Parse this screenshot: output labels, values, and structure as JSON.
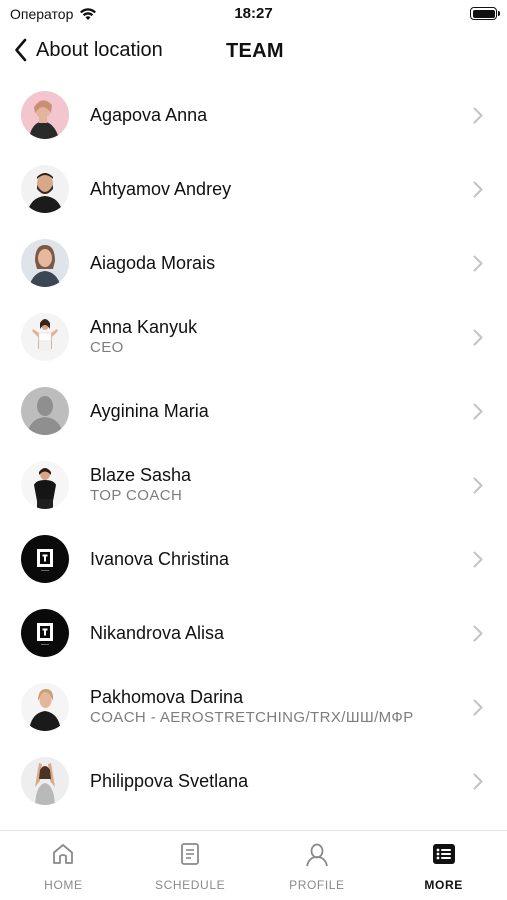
{
  "status": {
    "carrier": "Оператор",
    "time": "18:27"
  },
  "nav": {
    "back_label": "About location",
    "title": "TEAM"
  },
  "members": [
    {
      "name": "Agapova Anna",
      "role": "",
      "avatar": "photo-portrait"
    },
    {
      "name": "Ahtyamov Andrey",
      "role": "",
      "avatar": "photo-portrait"
    },
    {
      "name": "Aiagoda Morais",
      "role": "",
      "avatar": "photo-portrait"
    },
    {
      "name": "Anna Kanyuk",
      "role": "CEO",
      "avatar": "photo-portrait"
    },
    {
      "name": "Ayginina Maria",
      "role": "",
      "avatar": "placeholder-silhouette"
    },
    {
      "name": "Blaze Sasha",
      "role": "TOP COACH",
      "avatar": "photo-portrait"
    },
    {
      "name": "Ivanova Christina",
      "role": "",
      "avatar": "brand-logo"
    },
    {
      "name": "Nikandrova Alisa",
      "role": "",
      "avatar": "brand-logo"
    },
    {
      "name": "Pakhomova Darina",
      "role": "COACH - AEROSTRETCHING/TRX/ШШ/МФР",
      "avatar": "photo-portrait"
    },
    {
      "name": "Philippova Svetlana",
      "role": "",
      "avatar": "photo-portrait"
    },
    {
      "name": "",
      "role": "",
      "avatar": "brand-logo"
    }
  ],
  "tabs": [
    {
      "id": "home",
      "label": "HOME",
      "icon": "home-icon",
      "active": false
    },
    {
      "id": "schedule",
      "label": "SCHEDULE",
      "icon": "document-icon",
      "active": false
    },
    {
      "id": "profile",
      "label": "PROFILE",
      "icon": "person-icon",
      "active": false
    },
    {
      "id": "more",
      "label": "MORE",
      "icon": "list-icon",
      "active": true
    }
  ]
}
